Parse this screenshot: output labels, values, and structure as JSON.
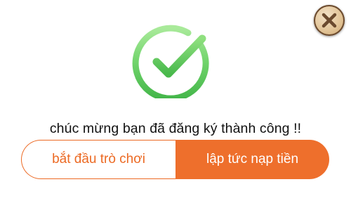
{
  "dialog": {
    "close_icon": "close-icon",
    "success_icon": "check-circle-icon",
    "message": "chúc mừng bạn đã đăng ký thành công !!",
    "buttons": {
      "start_game_label": "bắt đầu trò chơi",
      "top_up_label": "lập tức nạp tiền"
    },
    "colors": {
      "accent": "#EE6F2C",
      "success_green": "#6FD36A",
      "close_button_bg": "#E2C497",
      "close_icon": "#6B4A2E"
    }
  }
}
